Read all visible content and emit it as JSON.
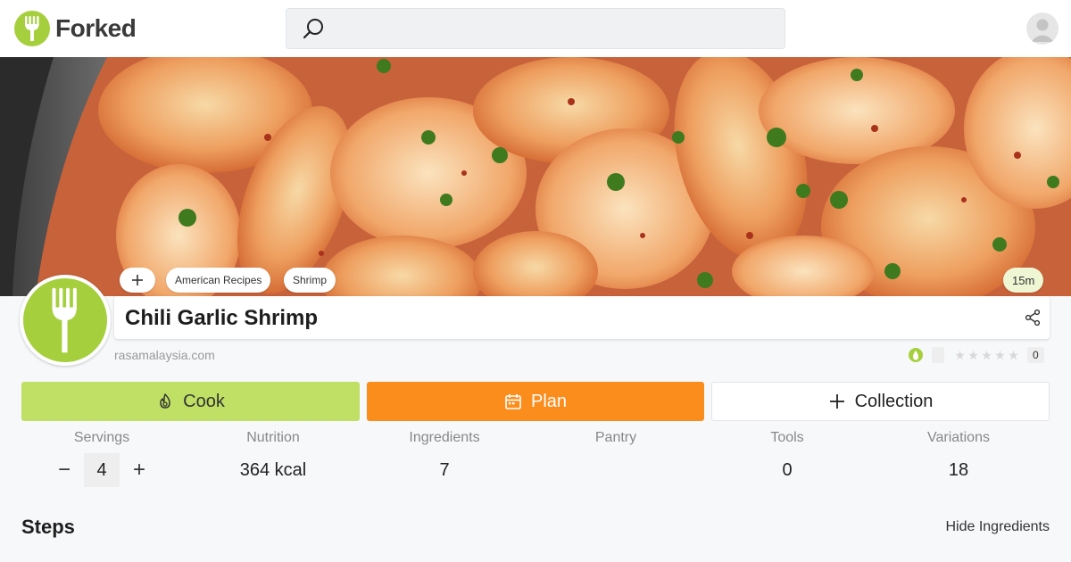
{
  "app": {
    "name": "Forked"
  },
  "search": {
    "placeholder": "",
    "value": ""
  },
  "hero": {
    "tags": [
      "American Recipes",
      "Shrimp"
    ],
    "add_tag_label": "+",
    "time": "15m"
  },
  "recipe": {
    "title": "Chili Garlic Shrimp",
    "source": "rasamalaysia.com",
    "rating_count": "0"
  },
  "actions": {
    "cook": "Cook",
    "plan": "Plan",
    "collection": "Collection"
  },
  "stats": {
    "servings_label": "Servings",
    "servings_value": "4",
    "minus": "−",
    "plus": "+",
    "nutrition_label": "Nutrition",
    "nutrition_value": "364 kcal",
    "ingredients_label": "Ingredients",
    "ingredients_value": "7",
    "pantry_label": "Pantry",
    "pantry_value": "",
    "tools_label": "Tools",
    "tools_value": "0",
    "variations_label": "Variations",
    "variations_value": "18"
  },
  "steps": {
    "title": "Steps",
    "hide_ingredients": "Hide Ingredients"
  },
  "colors": {
    "brand_green": "#a6cf3d",
    "cook_green": "#bfe065",
    "plan_orange": "#fb8d1d"
  },
  "icons": [
    "fork-icon",
    "search-icon",
    "avatar-icon",
    "share-icon",
    "flame-icon",
    "calendar-icon",
    "plus-icon",
    "star-icon"
  ]
}
